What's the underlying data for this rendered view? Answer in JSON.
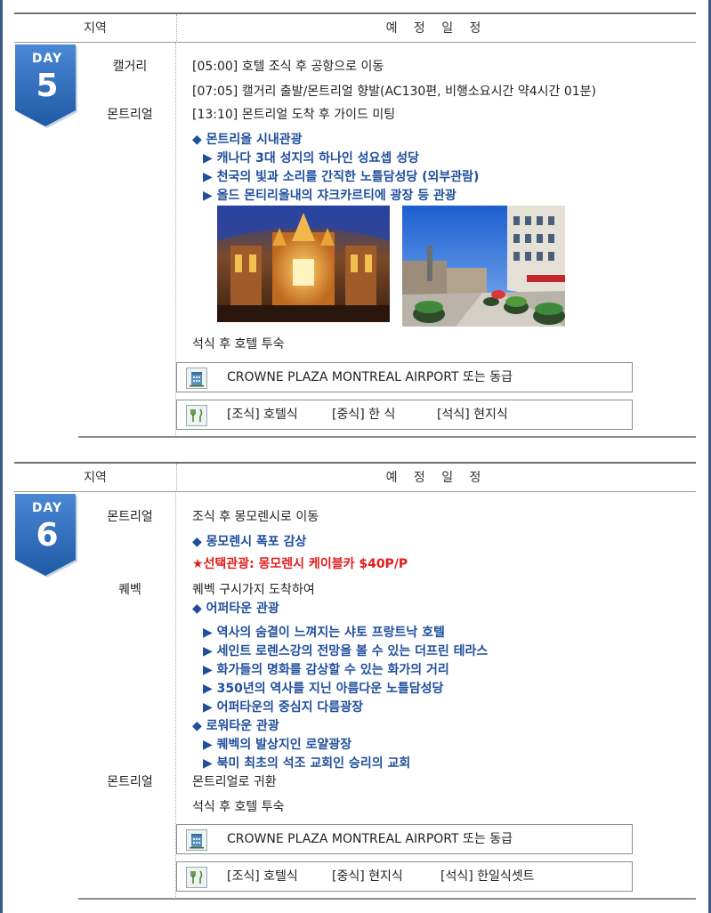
{
  "header": {
    "region": "지역",
    "schedule": "예 정 일 정"
  },
  "days": [
    {
      "day_label": "DAY",
      "day_number": "5",
      "regions": [
        "캘거리",
        "몬트리얼"
      ],
      "lines": [
        "[05:00] 호텔 조식 후 공항으로 이동",
        "[07:05] 캘거리 출발/몬트리얼 향발(AC130편, 비행소요시간 약4시간 01분)",
        "[13:10] 몬트리얼 도착 후 가이드 미팅"
      ],
      "tour_title": "◆ 몬트리올 시내관광",
      "tour_items": [
        "▶ 캐나다 3대 성지의 하나인 성요셉 성당",
        "▶ 천국의 빛과 소리를 간직한 노틀담성당 (외부관람)",
        "▶ 올드 몬티리올내의 쟈크카르티에 광장 등 관광"
      ],
      "after_photos": "석식 후 호텔 투숙",
      "hotel": "CROWNE PLAZA MONTREAL AIRPORT 또는 동급",
      "meals": {
        "breakfast": "[조식] 호텔식",
        "lunch": "[중식] 한  식",
        "dinner": "[석식] 현지식"
      }
    },
    {
      "day_label": "DAY",
      "day_number": "6",
      "regions": [
        "몬트리얼",
        "퀘벡",
        "몬트리얼"
      ],
      "line1": "조식 후 몽모렌시로 이동",
      "falls": "◆ 몽모렌시 폭포 감상",
      "option": "★선택관광: 몽모렌시 케이블카 $40P/P",
      "quebec_arrive": "퀘벡 구시가지 도착하여",
      "upper_title": "◆ 어퍼타운 관광",
      "upper_items": [
        "▶ 역사의 숨결이 느껴지는 샤토 프랑트낙 호텔",
        "▶ 세인트 로렌스강의 전망을 볼 수 있는 더프린 테라스",
        "▶ 화가들의 명화를 감상할 수 있는 화가의 거리",
        "▶ 350년의 역사를 지닌 아름다운 노틀담성당",
        "▶ 어퍼타운의 중심지 다름광장"
      ],
      "lower_title": "◆ 로워타운 관광",
      "lower_items": [
        "▶ 퀘벡의 발상지인 로얄광장",
        "▶ 북미 최초의 석조 교회인 승리의 교회"
      ],
      "return": "몬트리얼로 귀환",
      "after": "석식 후 호텔 투숙",
      "hotel": "CROWNE PLAZA MONTREAL AIRPORT 또는 동급",
      "meals": {
        "breakfast": "[조식] 호텔식",
        "lunch": "[중식] 현지식",
        "dinner": "[석식] 한일식셋트"
      }
    }
  ],
  "icons": {
    "hotel": "building-icon",
    "meal": "fork-knife-icon"
  },
  "colors": {
    "badge": "#2f6db5",
    "tour_text": "#1f4e9c",
    "option_text": "#e41b1b",
    "frame": "#3b5b85"
  }
}
